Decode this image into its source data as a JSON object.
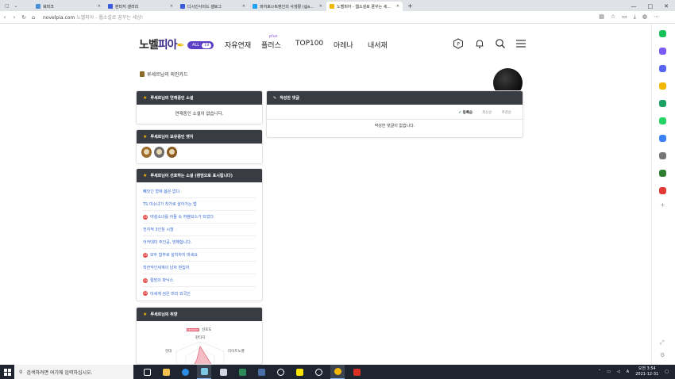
{
  "browser": {
    "tabs": [
      {
        "label": "북마크",
        "color": "#4a90d9",
        "active": false
      },
      {
        "label": "판타지 갤러리",
        "color": "#3b5bdb",
        "active": false
      },
      {
        "label": "디시인사이드 갤로그",
        "color": "#3b5bdb",
        "active": false
      },
      {
        "label": "피어호ㅂ트렌인의 사생활 (@s...",
        "color": "#1da1f2",
        "active": false
      },
      {
        "label": "노벨피아 - 웹소설로 꿈꾸는 세...",
        "color": "#f2b705",
        "active": true
      }
    ],
    "new_tab": "+",
    "window_controls": [
      "—",
      "□",
      "✕"
    ],
    "url_host": "novelpia.com",
    "url_title": "노벨피아 - 웹소설로 꿈꾸는 세상!"
  },
  "header": {
    "logo_main": "노벨",
    "logo_accent": "피아",
    "all_label": "ALL",
    "all_count": "19",
    "menu": [
      "자유연재",
      "플러스",
      "TOP100",
      "아레나",
      "내서재"
    ],
    "plus_sup": "plus"
  },
  "profile": {
    "title": "루세르님의 외인카드"
  },
  "cards": {
    "serializing": {
      "title": "루세르님의 연재중인 소설",
      "empty": "연재중인 소설이 없습니다."
    },
    "badges": {
      "title": "루세르님이 보유중인 뱃지"
    },
    "favorites": {
      "title": "루세르님이 선호하는 소설 (랜덤으로 표시됩니다)",
      "items": [
        {
          "label": "빼앗긴 형에 봄은 없다.",
          "adult": false
        },
        {
          "label": "TS 미소녀가 착가로 살아가는 법",
          "adult": false
        },
        {
          "label": "야설소녀를 아들 속 하렘보스가 되었다",
          "adult": true
        },
        {
          "label": "전지적 3인칭 시점",
          "adult": false
        },
        {
          "label": "어카데미 주인공, 방해합니다.",
          "adult": false
        },
        {
          "label": "모두 함부로 설치하지 마세요",
          "adult": true
        },
        {
          "label": "착한악인세계의 남자 편집자",
          "adult": false
        },
        {
          "label": "절망의 파닉스",
          "adult": true
        },
        {
          "label": "이세계 검은 머리 외국인",
          "adult": true
        }
      ],
      "adult_badge": "19"
    },
    "taste": {
      "title": "루세르님의 취향",
      "legend": "선호도",
      "labels": [
        "판타지",
        "라이트노벨",
        "현대"
      ]
    },
    "comments": {
      "title": "작성한 댓글",
      "sort": [
        "등록순",
        "최신순",
        "추천순"
      ],
      "empty": "작성한 댓글이 없습니다."
    }
  },
  "taskbar": {
    "search_placeholder": "검색하려면 여기에 입력하십시오.",
    "time": "오전 3:54",
    "date": "2021-12-31"
  },
  "colors": {
    "accent": "#5b3fc4",
    "card_header": "#393c43",
    "link": "#3568d4",
    "adult": "#e04848"
  }
}
